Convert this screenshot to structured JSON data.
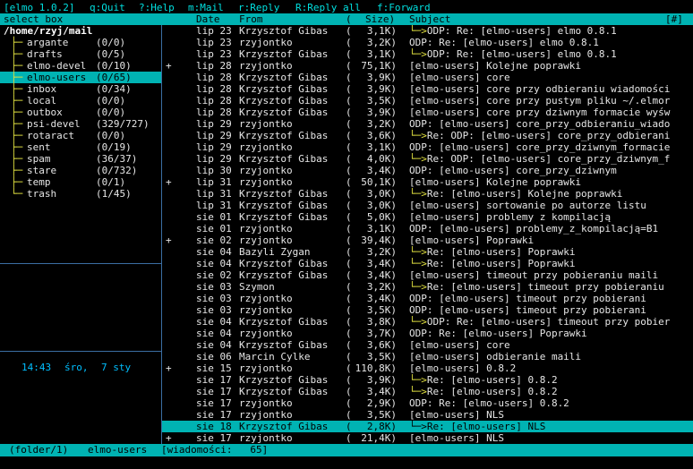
{
  "topbar": {
    "app": "[elmo 1.0.2]",
    "quit": "q:Quit",
    "help": "?:Help",
    "mail": "m:Mail",
    "reply": "r:Reply",
    "reply_all": "R:Reply all",
    "forward": "f:Forward"
  },
  "titlebar": {
    "select_box": "select box",
    "date": "Date",
    "from": "From",
    "size_open": "(",
    "size": "Size)",
    "subject": "Subject",
    "flags": "[#]"
  },
  "folders": {
    "root": "/home/rzyj/mail",
    "items": [
      {
        "name": "argante",
        "count": "(0/0)"
      },
      {
        "name": "drafts",
        "count": "(0/5)"
      },
      {
        "name": "elmo-devel",
        "count": "(0/10)"
      },
      {
        "name": "elmo-users",
        "count": "(0/65)"
      },
      {
        "name": "inbox",
        "count": "(0/34)"
      },
      {
        "name": "local",
        "count": "(0/0)"
      },
      {
        "name": "outbox",
        "count": "(0/0)"
      },
      {
        "name": "psi-devel",
        "count": "(329/727)"
      },
      {
        "name": "rotaract",
        "count": "(0/0)"
      },
      {
        "name": "sent",
        "count": "(0/19)"
      },
      {
        "name": "spam",
        "count": "(36/37)"
      },
      {
        "name": "stare",
        "count": "(0/732)"
      },
      {
        "name": "temp",
        "count": "(0/1)"
      },
      {
        "name": "trash",
        "count": "(1/45)"
      }
    ]
  },
  "clock": {
    "time": "14:43",
    "day": "śro,",
    "date": "7 sty"
  },
  "messages": [
    {
      "mark": "",
      "date": "lip 23",
      "from": "Krzysztof Gibas",
      "size": "3,1K)",
      "arrow": "└─>",
      "subject": "ODP: Re: [elmo-users] elmo 0.8.1"
    },
    {
      "mark": "",
      "date": "lip 23",
      "from": "rzyjontko",
      "size": "3,2K)",
      "arrow": "",
      "subject": "ODP: Re: [elmo-users] elmo 0.8.1"
    },
    {
      "mark": "",
      "date": "lip 23",
      "from": "Krzysztof Gibas",
      "size": "3,1K)",
      "arrow": "└─>",
      "subject": "ODP: Re: [elmo-users] elmo 0.8.1"
    },
    {
      "mark": "+",
      "date": "lip 28",
      "from": "rzyjontko",
      "size": "75,1K)",
      "arrow": "",
      "subject": "[elmo-users] Kolejne poprawki"
    },
    {
      "mark": "",
      "date": "lip 28",
      "from": "Krzysztof Gibas",
      "size": "3,9K)",
      "arrow": "",
      "subject": "[elmo-users] core"
    },
    {
      "mark": "",
      "date": "lip 28",
      "from": "Krzysztof Gibas",
      "size": "3,9K)",
      "arrow": "",
      "subject": "[elmo-users] core przy odbieraniu wiadomości"
    },
    {
      "mark": "",
      "date": "lip 28",
      "from": "Krzysztof Gibas",
      "size": "3,5K)",
      "arrow": "",
      "subject": "[elmo-users] core przy pustym pliku ~/.elmor"
    },
    {
      "mark": "",
      "date": "lip 28",
      "from": "Krzysztof Gibas",
      "size": "3,9K)",
      "arrow": "",
      "subject": "[elmo-users] core przy dziwnym formacie wyśw"
    },
    {
      "mark": "",
      "date": "lip 29",
      "from": "rzyjontko",
      "size": "3,2K)",
      "arrow": "",
      "subject": "ODP: [elmo-users] core_przy_odbieraniu_wiado"
    },
    {
      "mark": "",
      "date": "lip 29",
      "from": "Krzysztof Gibas",
      "size": "3,6K)",
      "arrow": "└─>",
      "subject": "Re: ODP: [elmo-users] core_przy_odbierani"
    },
    {
      "mark": "",
      "date": "lip 29",
      "from": "rzyjontko",
      "size": "3,1K)",
      "arrow": "",
      "subject": "ODP: [elmo-users] core_przy_dziwnym_formacie"
    },
    {
      "mark": "",
      "date": "lip 29",
      "from": "Krzysztof Gibas",
      "size": "4,0K)",
      "arrow": "└─>",
      "subject": "Re: ODP: [elmo-users] core_przy_dziwnym_f"
    },
    {
      "mark": "",
      "date": "lip 30",
      "from": "rzyjontko",
      "size": "3,4K)",
      "arrow": "",
      "subject": "ODP: [elmo-users] core_przy_dziwnym"
    },
    {
      "mark": "+",
      "date": "lip 31",
      "from": "rzyjontko",
      "size": "50,1K)",
      "arrow": "",
      "subject": "[elmo-users] Kolejne poprawki"
    },
    {
      "mark": "",
      "date": "lip 31",
      "from": "Krzysztof Gibas",
      "size": "3,0K)",
      "arrow": "└─>",
      "subject": "Re: [elmo-users] Kolejne poprawki"
    },
    {
      "mark": "",
      "date": "lip 31",
      "from": "Krzysztof Gibas",
      "size": "3,0K)",
      "arrow": "",
      "subject": "[elmo-users] sortowanie po autorze listu"
    },
    {
      "mark": "",
      "date": "sie 01",
      "from": "Krzysztof Gibas",
      "size": "5,0K)",
      "arrow": "",
      "subject": "[elmo-users] problemy z kompilacją"
    },
    {
      "mark": "",
      "date": "sie 01",
      "from": "rzyjontko",
      "size": "3,1K)",
      "arrow": "",
      "subject": "ODP: [elmo-users] problemy_z_kompilacją=B1"
    },
    {
      "mark": "+",
      "date": "sie 02",
      "from": "rzyjontko",
      "size": "39,4K)",
      "arrow": "",
      "subject": "[elmo-users] Poprawki"
    },
    {
      "mark": "",
      "date": "sie 04",
      "from": "Bazyli Zygan",
      "size": "3,2K)",
      "arrow": "└─>",
      "subject": "Re: [elmo-users] Poprawki"
    },
    {
      "mark": "",
      "date": "sie 04",
      "from": "Krzysztof Gibas",
      "size": "3,4K)",
      "arrow": "└─>",
      "subject": "Re: [elmo-users] Poprawki"
    },
    {
      "mark": "",
      "date": "sie 02",
      "from": "Krzysztof Gibas",
      "size": "3,4K)",
      "arrow": "",
      "subject": "[elmo-users] timeout przy pobieraniu maili"
    },
    {
      "mark": "",
      "date": "sie 03",
      "from": "Szymon",
      "size": "3,2K)",
      "arrow": "└─>",
      "subject": "Re: [elmo-users] timeout przy pobieraniu"
    },
    {
      "mark": "",
      "date": "sie 03",
      "from": "rzyjontko",
      "size": "3,4K)",
      "arrow": "",
      "subject": "ODP: [elmo-users] timeout przy pobierani"
    },
    {
      "mark": "",
      "date": "sie 03",
      "from": "rzyjontko",
      "size": "3,5K)",
      "arrow": "",
      "subject": "ODP: [elmo-users] timeout przy pobierani"
    },
    {
      "mark": "",
      "date": "sie 04",
      "from": "Krzysztof Gibas",
      "size": "3,8K)",
      "arrow": "└─>",
      "subject": "ODP: Re: [elmo-users] timeout przy pobier"
    },
    {
      "mark": "",
      "date": "sie 04",
      "from": "rzyjontko",
      "size": "3,7K)",
      "arrow": "",
      "subject": "ODP: Re: [elmo-users] Poprawki"
    },
    {
      "mark": "",
      "date": "sie 04",
      "from": "Krzysztof Gibas",
      "size": "3,6K)",
      "arrow": "",
      "subject": "[elmo-users] core"
    },
    {
      "mark": "",
      "date": "sie 06",
      "from": "Marcin Cylke",
      "size": "3,5K)",
      "arrow": "",
      "subject": "[elmo-users] odbieranie maili"
    },
    {
      "mark": "+",
      "date": "sie 15",
      "from": "rzyjontko",
      "size": "110,8K)",
      "arrow": "",
      "subject": "[elmo-users] 0.8.2"
    },
    {
      "mark": "",
      "date": "sie 17",
      "from": "Krzysztof Gibas",
      "size": "3,9K)",
      "arrow": "└─>",
      "subject": "Re: [elmo-users] 0.8.2"
    },
    {
      "mark": "",
      "date": "sie 17",
      "from": "Krzysztof Gibas",
      "size": "3,4K)",
      "arrow": "└─>",
      "subject": "Re: [elmo-users] 0.8.2"
    },
    {
      "mark": "",
      "date": "sie 17",
      "from": "rzyjontko",
      "size": "2,9K)",
      "arrow": "",
      "subject": "ODP: Re: [elmo-users] 0.8.2"
    },
    {
      "mark": "",
      "date": "sie 17",
      "from": "rzyjontko",
      "size": "3,5K)",
      "arrow": "",
      "subject": "[elmo-users] NLS"
    },
    {
      "mark": "",
      "date": "sie 18",
      "from": "Krzysztof Gibas",
      "size": "2,8K)",
      "arrow": "└─>",
      "subject": "Re: [elmo-users] NLS"
    },
    {
      "mark": "+",
      "date": "sie 17",
      "from": "rzyjontko",
      "size": "21,4K)",
      "arrow": "",
      "subject": "[elmo-users] NLS"
    }
  ],
  "selected_message_index": 34,
  "selected_folder_index": 3,
  "bottombar": {
    "folder": "(folder/1)",
    "name": "elmo-users",
    "messages": "[wiadomości:   65]"
  },
  "colors": {
    "accent": "#00b3b3",
    "tree": "#e0e040",
    "clock": "#00bfff",
    "topbar_text": "#00e0e0"
  }
}
